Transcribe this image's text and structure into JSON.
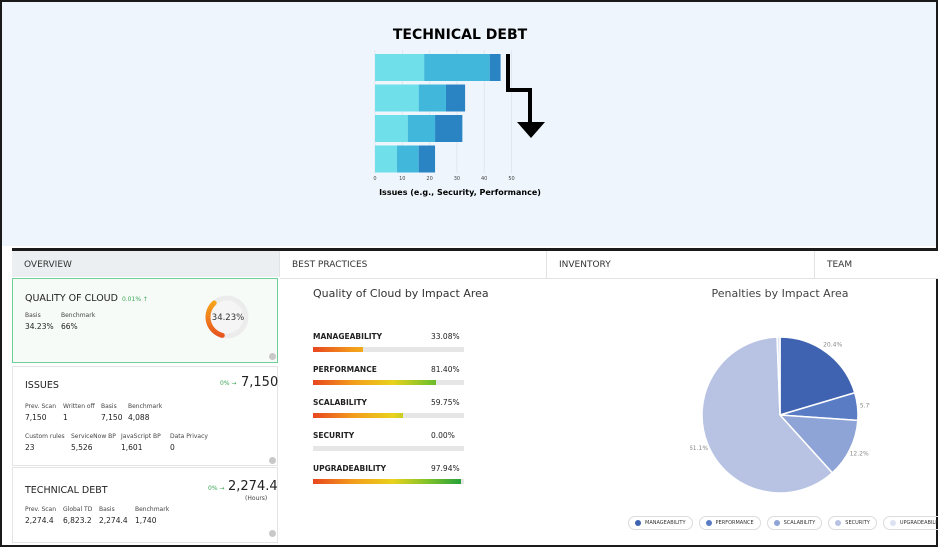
{
  "banner": {
    "title": "TECHNICAL DEBT",
    "xlabel": "Issues (e.g., Security, Performance)",
    "colors": [
      "#6fe0ea",
      "#41b8db",
      "#2a84c4"
    ]
  },
  "chart_data": {
    "type": "bar",
    "orientation": "horizontal",
    "stacked": true,
    "categories": [
      "",
      "",
      "",
      ""
    ],
    "series": [
      {
        "values": [
          18,
          16,
          12,
          8
        ]
      },
      {
        "values": [
          24,
          10,
          10,
          8
        ]
      },
      {
        "values": [
          4,
          7,
          10,
          6
        ]
      }
    ],
    "xticks": [
      "0",
      "10",
      "20",
      "30",
      "40",
      "50"
    ],
    "xlim": [
      0,
      50
    ],
    "xlabel": "Issues (e.g., Security, Performance)",
    "title": "TECHNICAL DEBT"
  },
  "tabs": [
    {
      "label": "OVERVIEW",
      "active": true
    },
    {
      "label": "BEST PRACTICES",
      "active": false
    },
    {
      "label": "INVENTORY",
      "active": false
    },
    {
      "label": "TEAM",
      "active": false
    }
  ],
  "quality": {
    "title": "QUALITY OF CLOUD",
    "delta": "0.01% ↑",
    "basis_label": "Basis",
    "basis_value": "34.23%",
    "benchmark_label": "Benchmark",
    "benchmark_value": "66%",
    "gauge_value": "34.23%",
    "gauge_fraction": 0.3423
  },
  "issues": {
    "title": "ISSUES",
    "delta": "0% →",
    "value": "7,150",
    "stats1": [
      {
        "label": "Prev. Scan",
        "value": "7,150"
      },
      {
        "label": "Written off",
        "value": "1"
      },
      {
        "label": "Basis",
        "value": "7,150"
      },
      {
        "label": "Benchmark",
        "value": "4,088"
      }
    ],
    "stats2": [
      {
        "label": "Custom rules",
        "value": "23"
      },
      {
        "label": "ServiceNow BP",
        "value": "5,526"
      },
      {
        "label": "JavaScript BP",
        "value": "1,601"
      },
      {
        "label": "Data Privacy",
        "value": "0"
      }
    ]
  },
  "techdebt": {
    "title": "TECHNICAL DEBT",
    "delta": "0% →",
    "value": "2,274.4",
    "unit": "(Hours)",
    "stats": [
      {
        "label": "Prev. Scan",
        "value": "2,274.4"
      },
      {
        "label": "Global TD",
        "value": "6,823.2"
      },
      {
        "label": "Basis",
        "value": "2,274.4"
      },
      {
        "label": "Benchmark",
        "value": "1,740"
      }
    ]
  },
  "impact": {
    "title": "Quality of Cloud by Impact Area",
    "rows": [
      {
        "name": "MANAGEABILITY",
        "pct": "33.08%",
        "value": 33.08
      },
      {
        "name": "PERFORMANCE",
        "pct": "81.40%",
        "value": 81.4
      },
      {
        "name": "SCALABILITY",
        "pct": "59.75%",
        "value": 59.75
      },
      {
        "name": "SECURITY",
        "pct": "0.00%",
        "value": 0.0
      },
      {
        "name": "UPGRADEABILITY",
        "pct": "97.94%",
        "value": 97.94
      }
    ]
  },
  "penalties": {
    "title": "Penalties by Impact Area",
    "slices": [
      {
        "name": "MANAGEABILITY",
        "value": 20.4,
        "label": "20.4%",
        "color": "#3f63b0"
      },
      {
        "name": "PERFORMANCE",
        "value": 5.7,
        "label": "5.7%",
        "color": "#5a7cc4"
      },
      {
        "name": "SCALABILITY",
        "value": 12.2,
        "label": "12.2%",
        "color": "#8ea3d6"
      },
      {
        "name": "SECURITY",
        "value": 61.1,
        "label": "61.1%",
        "color": "#b8c3e3"
      },
      {
        "name": "UPGRADEABILITY",
        "value": 0.6,
        "label": "",
        "color": "#dde2f1"
      }
    ],
    "legend": [
      "MANAGEABILITY",
      "PERFORMANCE",
      "SCALABILITY",
      "SECURITY",
      "UPGRADEABILITY"
    ]
  }
}
